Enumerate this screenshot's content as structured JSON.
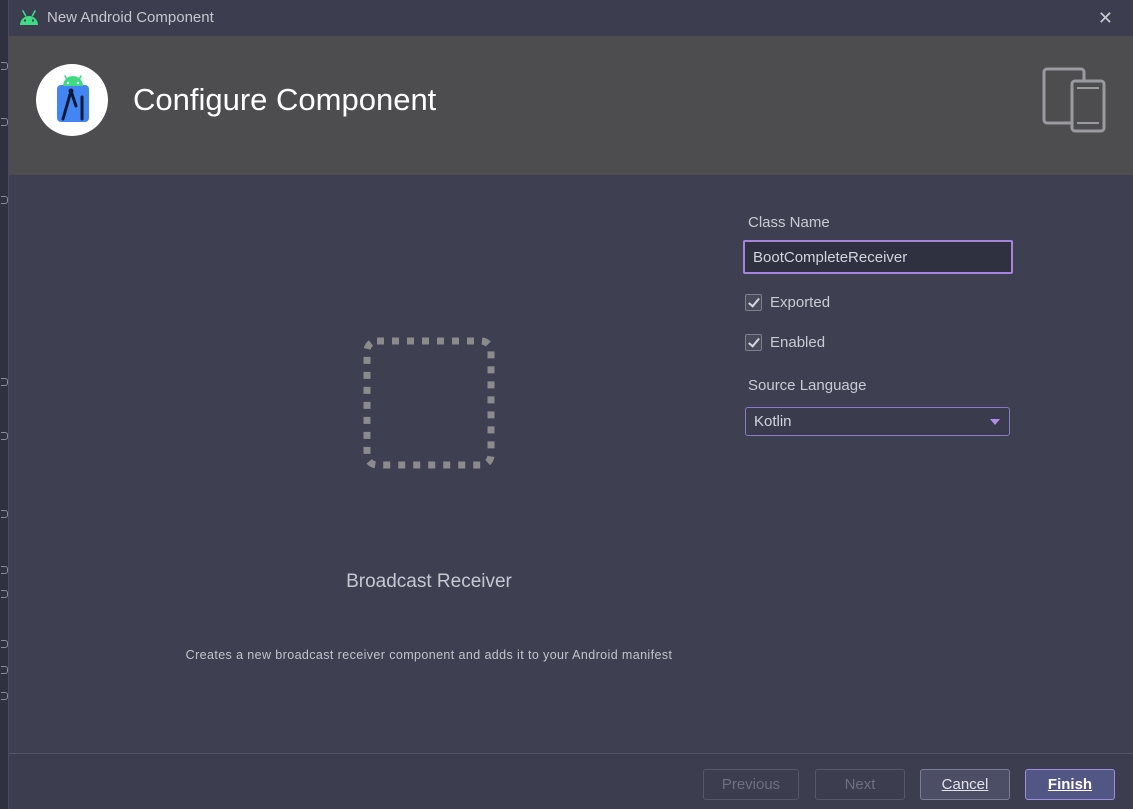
{
  "window": {
    "title": "New Android Component",
    "close_symbol": "✕"
  },
  "banner": {
    "heading": "Configure Component",
    "logo_icon": "android-studio-logo-icon",
    "devices_icon": "phone-tablet-icon"
  },
  "component": {
    "name": "Broadcast Receiver",
    "description": "Creates a new broadcast receiver component and adds it to your Android manifest"
  },
  "form": {
    "class_name_label": "Class Name",
    "class_name_value": "BootCompleteReceiver",
    "exported_label": "Exported",
    "exported_checked": true,
    "enabled_label": "Enabled",
    "enabled_checked": true,
    "source_language_label": "Source Language",
    "source_language_value": "Kotlin"
  },
  "buttons": {
    "previous": "Previous",
    "next": "Next",
    "cancel": "Cancel",
    "finish": "Finish"
  },
  "colors": {
    "accent": "#a783e0",
    "android_green": "#3ddc84",
    "banner_bg": "#4d4d4f",
    "dialog_bg": "#3e3f50"
  }
}
